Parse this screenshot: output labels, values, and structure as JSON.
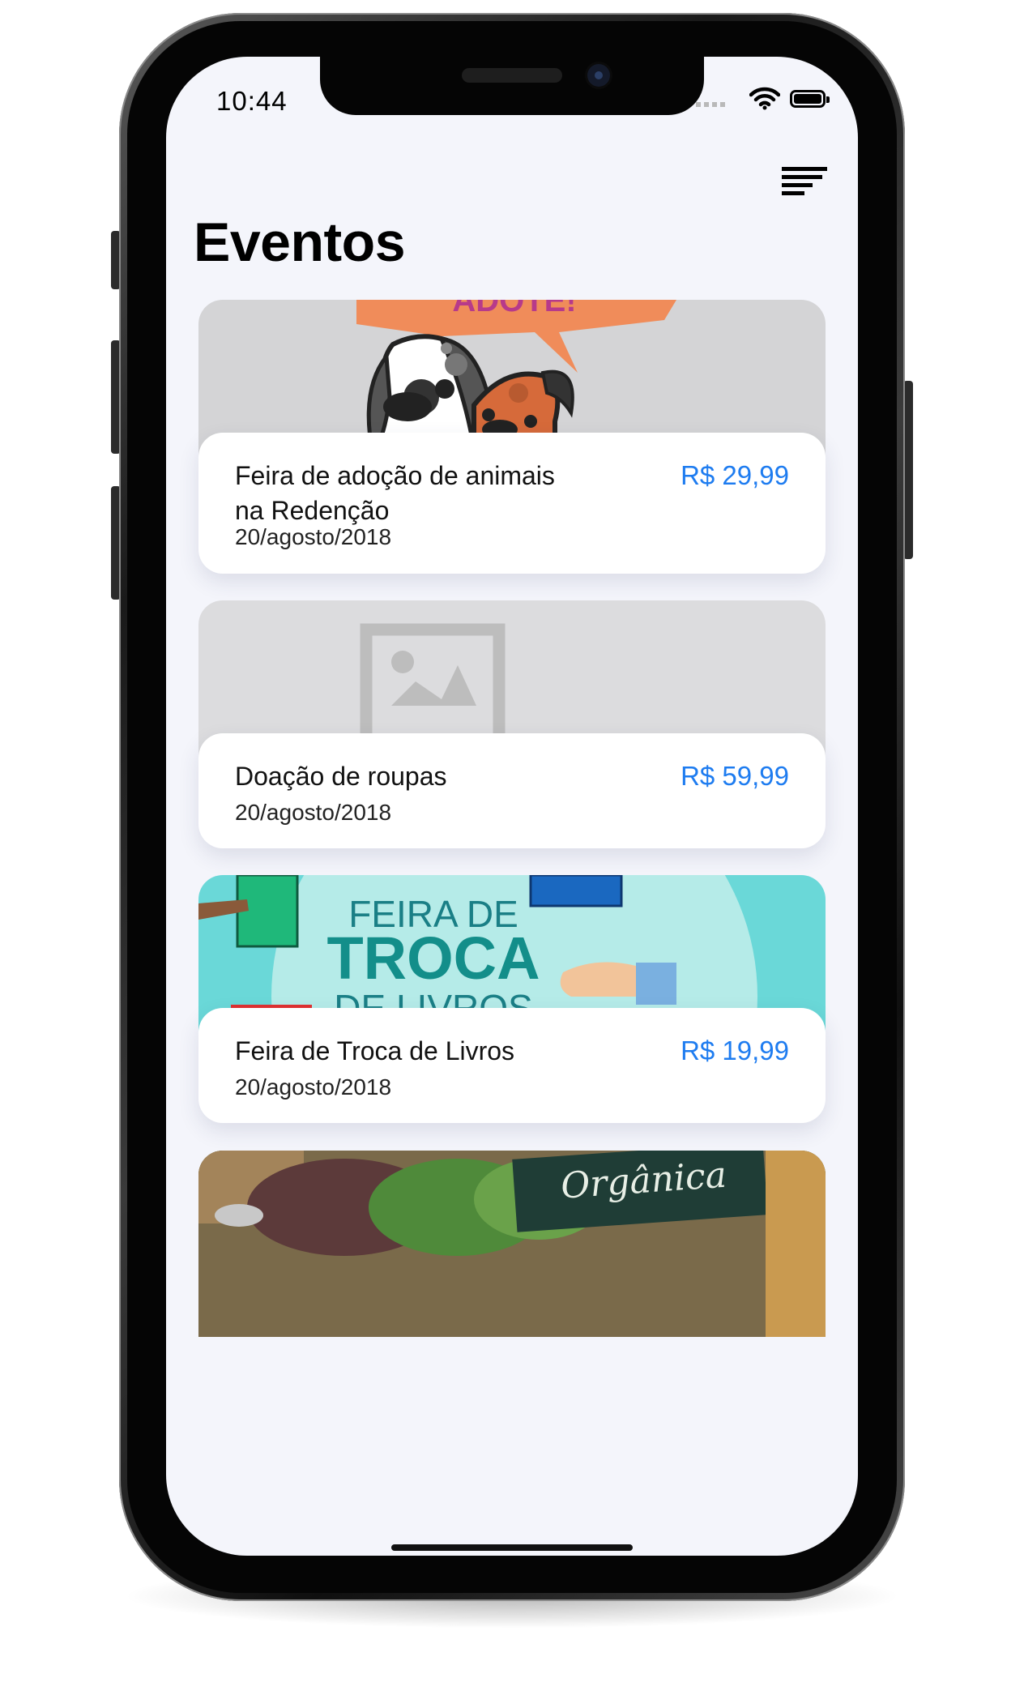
{
  "status_bar": {
    "time": "10:44"
  },
  "header": {
    "title": "Eventos"
  },
  "events": [
    {
      "title": "Feira de adoção de animais na Redenção",
      "price": "R$ 29,99",
      "date": "20/agosto/2018",
      "image": "dogs-adoption-illustration"
    },
    {
      "title": "Doação de roupas",
      "price": "R$ 59,99",
      "date": "20/agosto/2018",
      "image": "image-placeholder"
    },
    {
      "title": "Feira de Troca de Livros",
      "price": "R$ 19,99",
      "date": "20/agosto/2018",
      "image": "book-fair-banner"
    },
    {
      "image": "organic-vegetables-photo"
    }
  ],
  "banner": {
    "line1": "FEIRA DE",
    "line2": "TROCA",
    "line3": "DE LIVROS",
    "tag": "ADOTE!"
  },
  "chalkboard": {
    "text": "Orgânica"
  },
  "colors": {
    "price": "#1e7cf0",
    "background": "#f4f5fb",
    "banner": "#6ad8d8"
  }
}
